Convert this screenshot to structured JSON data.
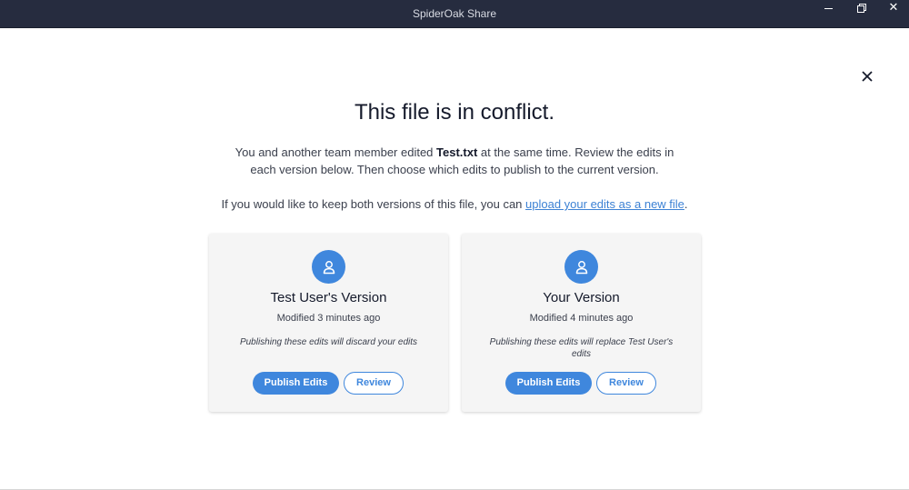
{
  "window": {
    "title": "SpiderOak Share",
    "controls": {
      "minimize": "minimize",
      "maximize": "restore",
      "close": "✕"
    }
  },
  "dialog": {
    "heading": "This file is in conflict.",
    "description_pre": "You and another team member edited ",
    "file_name": "Test.txt",
    "description_post": " at the same time. Review the edits in each version below. Then choose which edits to publish to the current version.",
    "note_pre": "If you would like to keep both versions of this file, you can ",
    "note_link": "upload your edits as a new file",
    "note_post": ".",
    "cards": [
      {
        "title": "Test User's Version",
        "modified": "Modified 3 minutes ago",
        "warning": "Publishing these edits will discard your edits",
        "publish_label": "Publish Edits",
        "review_label": "Review"
      },
      {
        "title": "Your Version",
        "modified": "Modified 4 minutes ago",
        "warning": "Publishing these edits will replace Test User's edits",
        "publish_label": "Publish Edits",
        "review_label": "Review"
      }
    ]
  },
  "colors": {
    "titlebar": "#262c3f",
    "accent": "#3f87dd",
    "link": "#3d82d4",
    "card_bg": "#f5f5f5"
  },
  "icons": {
    "close": "close-icon",
    "user": "user-icon"
  }
}
